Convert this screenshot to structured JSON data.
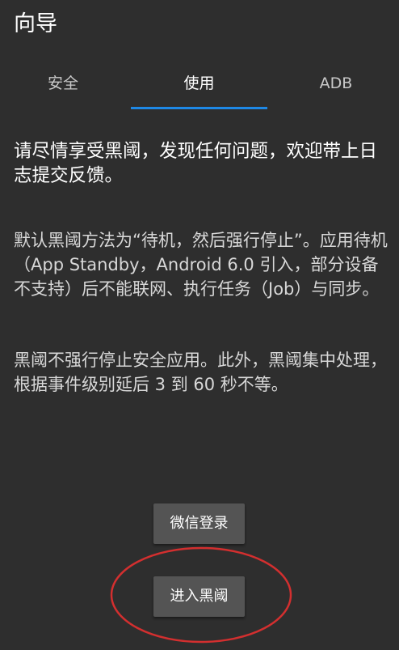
{
  "header": {
    "title": "向导"
  },
  "tabs": [
    {
      "label": "安全"
    },
    {
      "label": "使用"
    },
    {
      "label": "ADB"
    }
  ],
  "active_tab_index": 1,
  "content": {
    "headline": "请尽情享受黑阈，发现任何问题，欢迎带上日志提交反馈。",
    "paragraph1": "默认黑阈方法为“待机，然后强行停止”。应用待机（App Standby，Android 6.0 引入，部分设备不支持）后不能联网、执行任务（Job）与同步。",
    "paragraph2": "黑阈不强行停止安全应用。此外，黑阈集中处理，根据事件级别延后 3 到 60 秒不等。"
  },
  "buttons": {
    "wechat_login": "微信登录",
    "enter": "进入黑阈"
  },
  "colors": {
    "background": "#2e2e2e",
    "tab_indicator": "#1e88e5",
    "button": "#545454",
    "annotation_circle": "#d32f2f"
  }
}
